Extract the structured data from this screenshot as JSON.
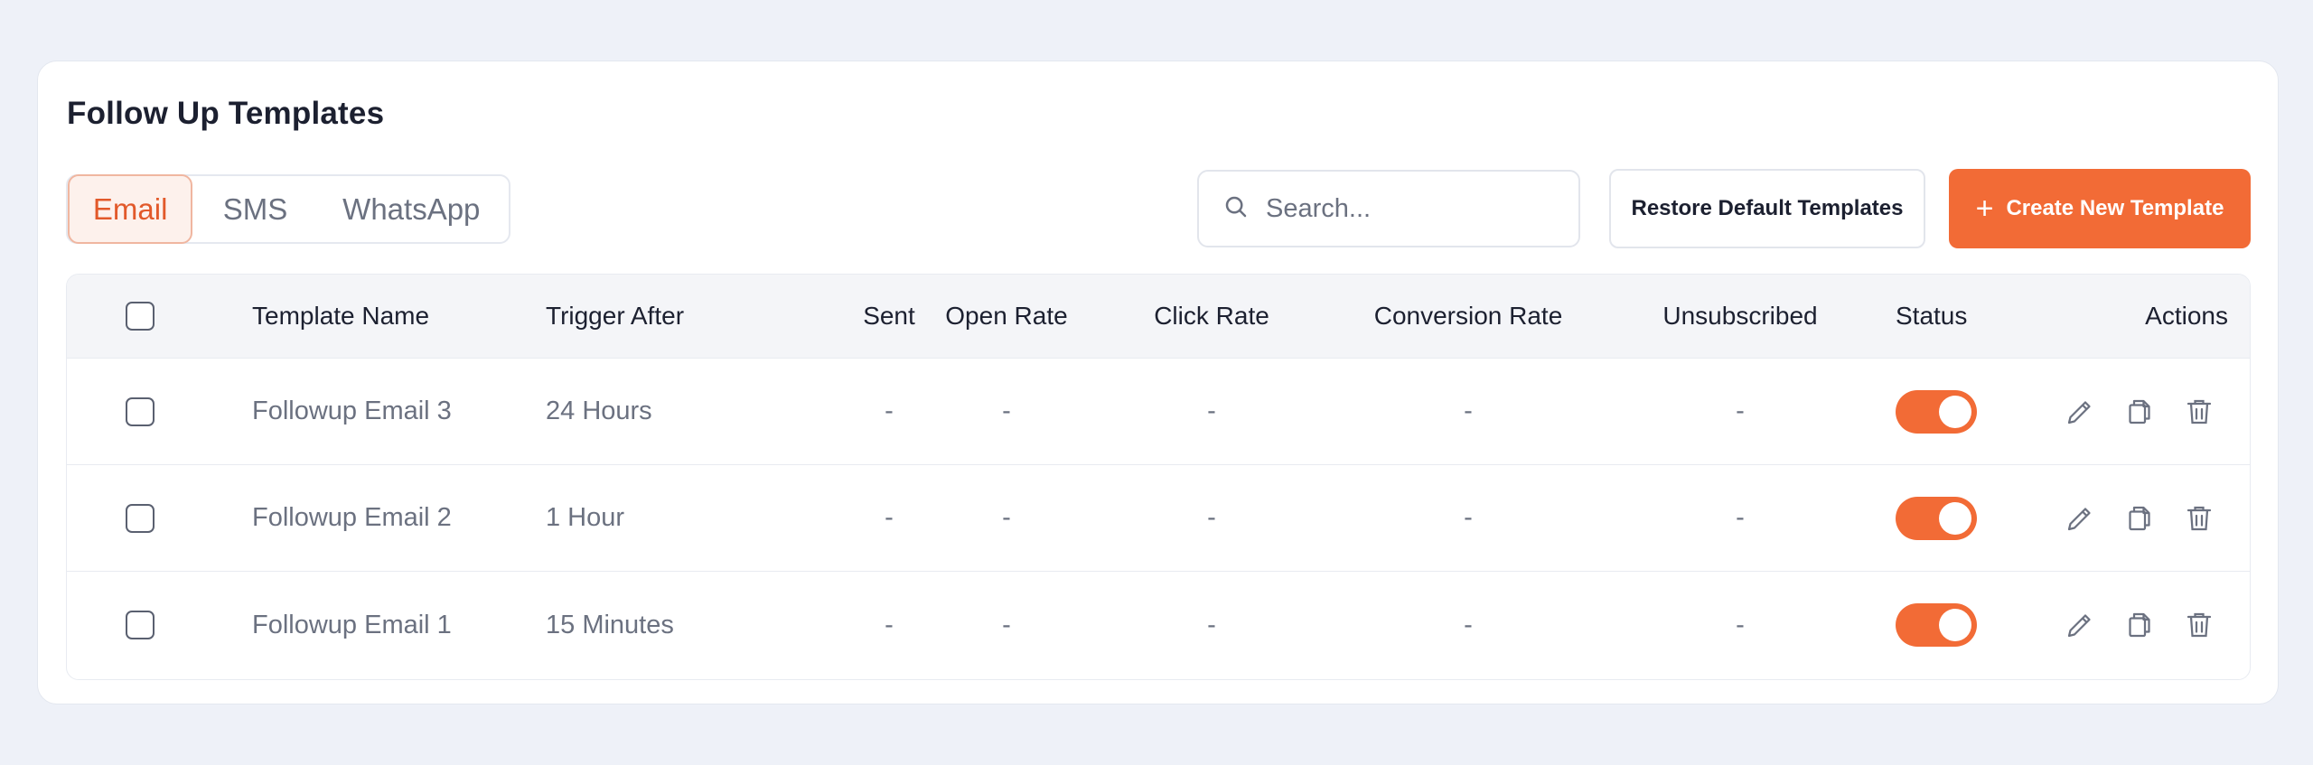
{
  "page_title": "Follow Up Templates",
  "tabs": [
    {
      "label": "Email",
      "active": true
    },
    {
      "label": "SMS",
      "active": false
    },
    {
      "label": "WhatsApp",
      "active": false
    }
  ],
  "search": {
    "placeholder": "Search..."
  },
  "buttons": {
    "restore_label": "Restore Default Templates",
    "create_label": "Create New Template"
  },
  "table": {
    "headers": {
      "template_name": "Template Name",
      "trigger_after": "Trigger After",
      "sent": "Sent",
      "open_rate": "Open Rate",
      "click_rate": "Click Rate",
      "conversion_rate": "Conversion Rate",
      "unsubscribed": "Unsubscribed",
      "status": "Status",
      "actions": "Actions"
    },
    "rows": [
      {
        "name": "Followup Email 3",
        "trigger": "24 Hours",
        "sent": "-",
        "open_rate": "-",
        "click_rate": "-",
        "conversion_rate": "-",
        "unsubscribed": "-",
        "status_on": true
      },
      {
        "name": "Followup Email 2",
        "trigger": "1 Hour",
        "sent": "-",
        "open_rate": "-",
        "click_rate": "-",
        "conversion_rate": "-",
        "unsubscribed": "-",
        "status_on": true
      },
      {
        "name": "Followup Email 1",
        "trigger": "15 Minutes",
        "sent": "-",
        "open_rate": "-",
        "click_rate": "-",
        "conversion_rate": "-",
        "unsubscribed": "-",
        "status_on": true
      }
    ]
  },
  "colors": {
    "accent": "#f26b36",
    "active_tab_text": "#e2592a",
    "background": "#eef1f8"
  },
  "icons": [
    "search-icon",
    "plus-icon",
    "edit-icon",
    "duplicate-icon",
    "delete-icon"
  ]
}
